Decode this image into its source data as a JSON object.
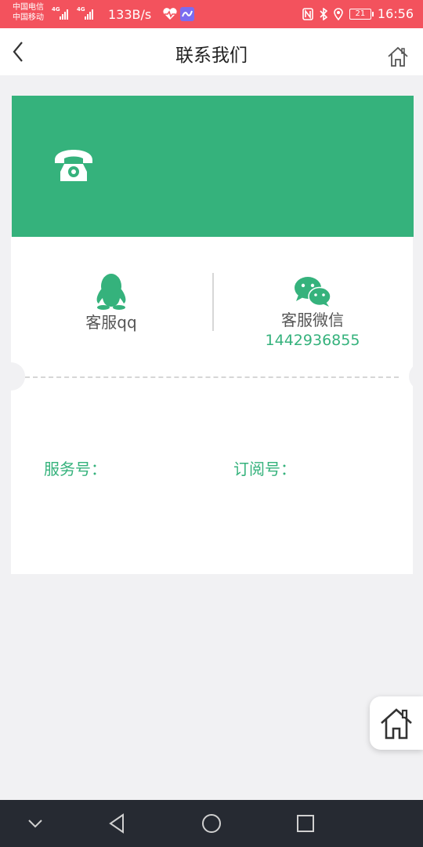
{
  "status_bar": {
    "carrier_1": "中国电信",
    "carrier_2": "中国移动",
    "signal_1": "4G",
    "signal_2": "4G",
    "speed": "133B/s",
    "battery": "21",
    "time": "16:56",
    "icons": [
      "heart-rate-icon",
      "app-notification-icon",
      "nfc-icon",
      "bluetooth-icon",
      "location-icon",
      "battery-icon"
    ]
  },
  "header": {
    "title": "联系我们",
    "back_icon": "chevron-left-icon",
    "home_icon": "home-icon"
  },
  "banner": {
    "icon": "telephone-icon",
    "color": "#35b27c"
  },
  "contacts": {
    "qq_label": "客服qq",
    "qq_value": "",
    "wechat_label": "客服微信",
    "wechat_value": "1442936855"
  },
  "accounts": {
    "service_label": "服务号：",
    "subscription_label": "订阅号："
  },
  "float_button": {
    "icon": "home-icon"
  },
  "nav_bar": {
    "icons": [
      "chevron-down-icon",
      "back-triangle-icon",
      "home-circle-icon",
      "recents-square-icon"
    ]
  },
  "colors": {
    "accent": "#35b27c",
    "status_bar": "#f3525d",
    "nav_bar": "#262a32",
    "background": "#f1f1f3"
  }
}
